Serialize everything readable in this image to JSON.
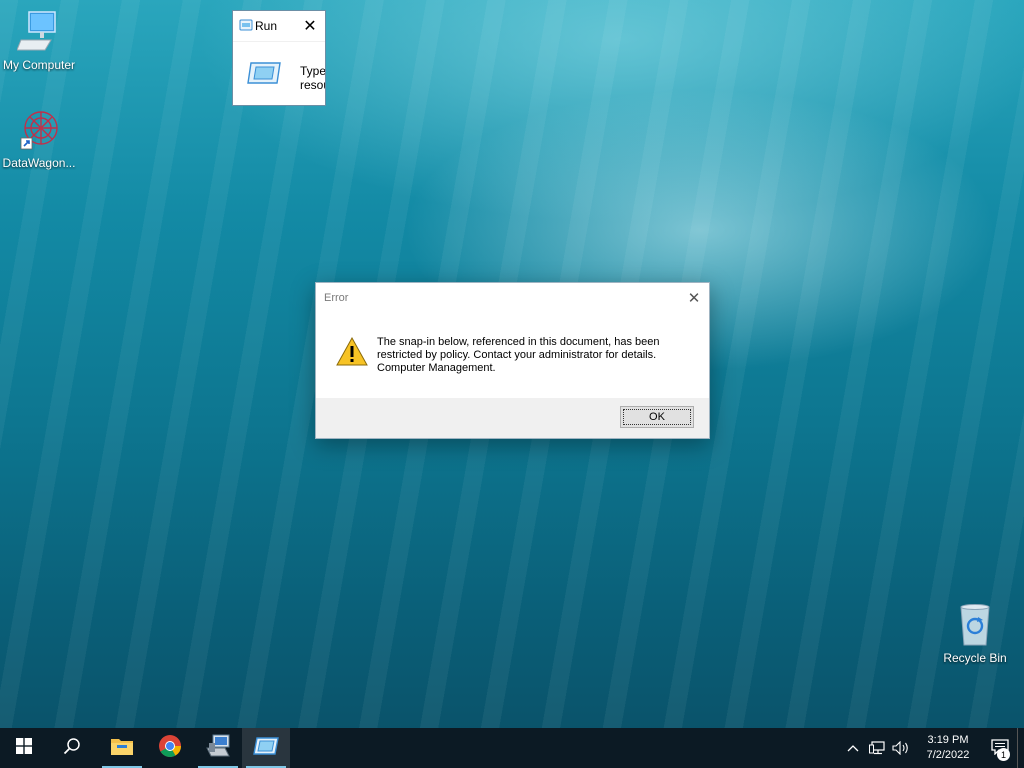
{
  "desktop": {
    "icons": [
      {
        "label": "My Computer",
        "icon": "computer-icon"
      },
      {
        "label": "DataWagon...",
        "icon": "datawagon-shortcut-icon"
      },
      {
        "label": "Recycle Bin",
        "icon": "recycle-bin-icon"
      }
    ]
  },
  "run_window": {
    "title": "Run",
    "close": "✕",
    "body_line1": "Type",
    "body_line2": "resou"
  },
  "error_dialog": {
    "title": "Error",
    "close": "✕",
    "message_line1": "The snap-in below, referenced in this document, has been",
    "message_line2": "restricted by policy. Contact your administrator for details.",
    "message_line3": "Computer Management.",
    "ok_label": "OK"
  },
  "taskbar": {
    "apps": [
      {
        "icon": "windows-start-icon"
      },
      {
        "icon": "search-icon"
      },
      {
        "icon": "file-explorer-icon"
      },
      {
        "icon": "chrome-icon"
      },
      {
        "icon": "server-manager-icon"
      },
      {
        "icon": "run-app-icon"
      }
    ],
    "clock": {
      "time": "3:19 PM",
      "date": "7/2/2022"
    },
    "notifications": "1",
    "tray_chevron": "^"
  },
  "colors": {
    "accent": "#7fc7e6",
    "taskbar": "#0c1a24",
    "dialog_footer": "#f0f0f0"
  }
}
